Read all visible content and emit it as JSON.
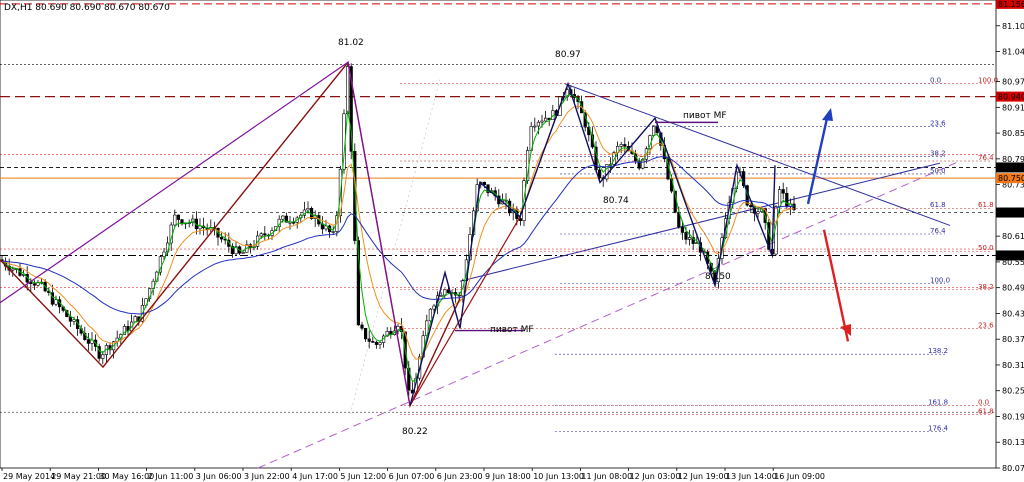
{
  "header": {
    "title": "DX,H1  80.690 80.690 80.670 80.670"
  },
  "chart_data": {
    "type": "candlestick",
    "ylim": [
      80.075,
      81.165
    ],
    "y_ticks": [
      "81.105",
      "81.045",
      "80.975",
      "80.915",
      "80.855",
      "80.795",
      "80.735",
      "80.675",
      "80.615",
      "80.555",
      "80.495",
      "80.435",
      "80.375",
      "80.315",
      "80.255",
      "80.195",
      "80.135",
      "80.075"
    ],
    "x_ticks": [
      "29 May 2014",
      "29 May 21:00",
      "30 May 16:00",
      "2 Jun 11:00",
      "3 Jun 06:00",
      "3 Jun 22:00",
      "4 Jun 17:00",
      "5 Jun 12:00",
      "6 Jun 07:00",
      "6 Jun 23:00",
      "9 Jun 18:00",
      "10 Jun 13:00",
      "11 Jun 08:00",
      "12 Jun 03:00",
      "12 Jun 19:00",
      "13 Jun 14:00",
      "16 Jun 09:00"
    ],
    "price_boxes": [
      {
        "value": "81.156",
        "color": "#d40000"
      },
      {
        "value": "80.940",
        "color": "#d40000"
      },
      {
        "value": "80.775",
        "color": "#000000"
      },
      {
        "value": "80.750",
        "color": "#f07818"
      },
      {
        "value": "80.670",
        "color": "#000000"
      },
      {
        "value": "80.570",
        "color": "#000000"
      }
    ],
    "annotations": [
      {
        "text": "81.02",
        "value": 81.02
      },
      {
        "text": "80.97",
        "value": 80.97
      },
      {
        "text": "80.74",
        "value": 80.74
      },
      {
        "text": "80.50",
        "value": 80.5
      },
      {
        "text": "80.22",
        "value": 80.22
      },
      {
        "text": "пивот MF",
        "value": 80.88
      },
      {
        "text": "пивот MF",
        "value": 80.4
      }
    ],
    "fib_upper": [
      "0.0",
      "23.6",
      "38.2",
      "50.0",
      "61.8",
      "76.4",
      "100.0"
    ],
    "fib_upper_red": [
      "100.0",
      "76.4",
      "61.8",
      "50.0",
      "38.2",
      "23.6",
      "0.0"
    ],
    "fib_lower": [
      "100.0",
      "138.2",
      "161.8",
      "176.4"
    ],
    "fib_right": [
      "76.4",
      "50.0",
      "100.0",
      "61.8"
    ],
    "colors": {
      "up": "#000000",
      "ema_fast": "#00b000",
      "ema_mid": "#f09020",
      "ema_slow": "#2030c0",
      "wave": "#8a1010",
      "arrow_up": "#2040c0",
      "arrow_down": "#e02020",
      "pivot": "#5a1080"
    }
  }
}
